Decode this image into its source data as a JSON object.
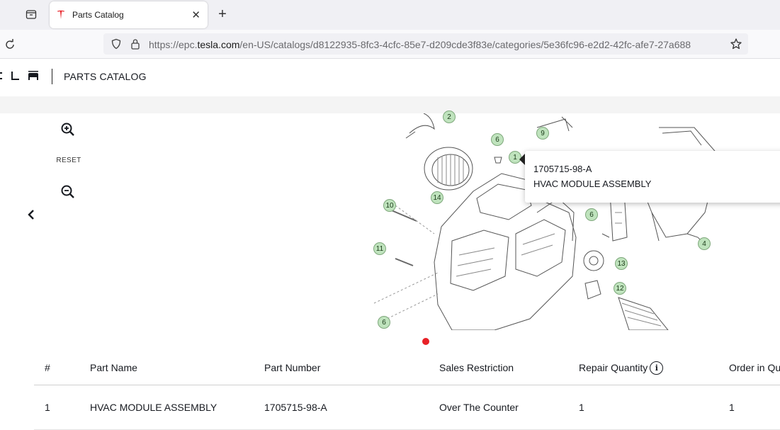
{
  "browser": {
    "tab_title": "Parts Catalog",
    "url_prefix": "https://epc.",
    "url_host": "tesla.com",
    "url_rest": "/en-US/catalogs/d8122935-8fc3-4cfc-85e7-d209cde3f83e/categories/5e36fc96-e2d2-42fc-afe7-27a688"
  },
  "header": {
    "title": "PARTS CATALOG"
  },
  "viewer": {
    "reset_label": "RESET"
  },
  "diagram": {
    "callouts": [
      "2",
      "6",
      "9",
      "1",
      "14",
      "10",
      "6",
      "11",
      "13",
      "12",
      "4",
      "6"
    ],
    "tooltip": {
      "part_number": "1705715-98-A",
      "part_name": "HVAC MODULE ASSEMBLY"
    }
  },
  "table": {
    "headers": [
      "#",
      "Part Name",
      "Part Number",
      "Sales Restriction",
      "Repair Quantity",
      "Order in Qu"
    ],
    "rows": [
      [
        "1",
        "HVAC MODULE ASSEMBLY",
        "1705715-98-A",
        "Over The Counter",
        "1",
        "1"
      ]
    ]
  },
  "colors": {
    "accent": "#e82127",
    "callout_fill": "#bfe3bd"
  }
}
